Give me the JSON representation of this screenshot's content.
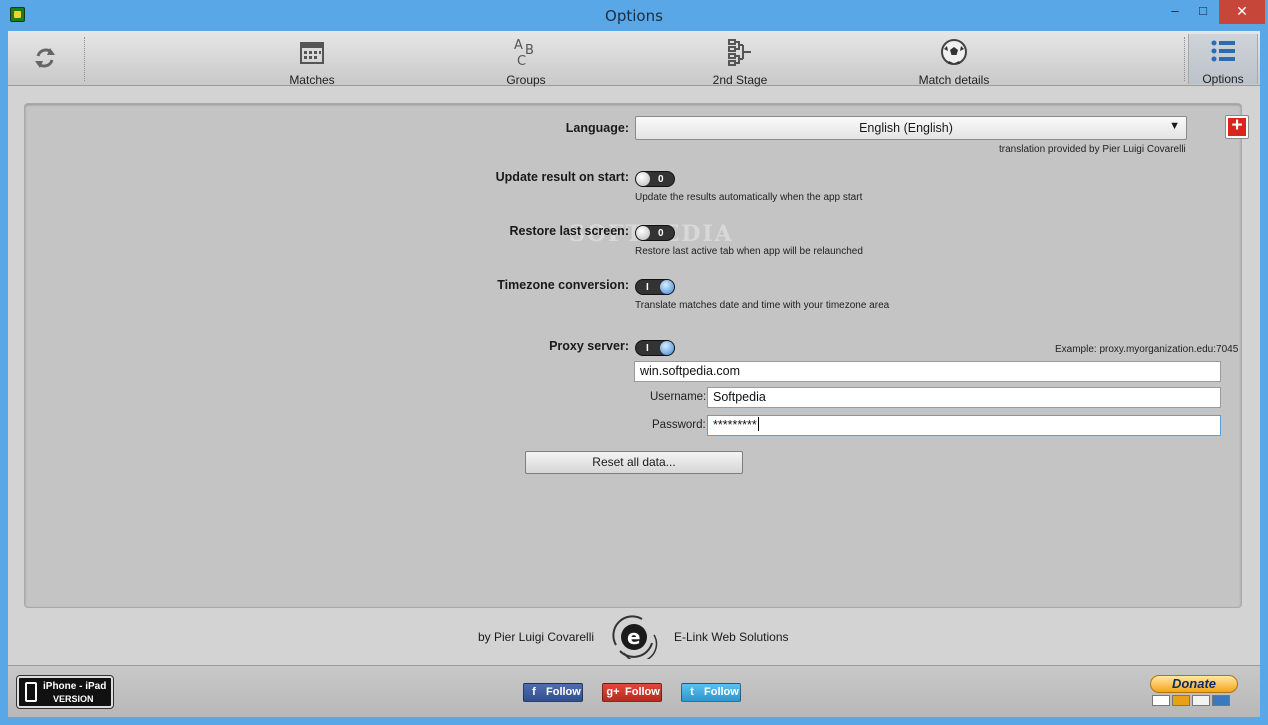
{
  "window": {
    "title": "Options",
    "minimize": "–",
    "maximize": "□",
    "close": "✕"
  },
  "toolbar": {
    "tabs": [
      {
        "label": "Matches",
        "icon": "calendar-icon"
      },
      {
        "label": "Groups",
        "icon": "abc-icon"
      },
      {
        "label": "2nd Stage",
        "icon": "bracket-icon"
      },
      {
        "label": "Match details",
        "icon": "soccer-ball-icon"
      },
      {
        "label": "Options",
        "icon": "list-icon",
        "active": true
      }
    ]
  },
  "options": {
    "language_label": "Language:",
    "language_value": "English (English)",
    "translation_credit": "translation provided by Pier Luigi Covarelli",
    "update_label": "Update result on start:",
    "update_state": "0",
    "update_hint": "Update the results automatically when the app start",
    "restore_label": "Restore last screen:",
    "restore_state": "0",
    "restore_hint": "Restore last active tab when app will be relaunched",
    "timezone_label": "Timezone conversion:",
    "timezone_state": "I",
    "timezone_hint": "Translate matches date and time with your timezone area",
    "proxy_label": "Proxy server:",
    "proxy_state": "I",
    "proxy_example": "Example: proxy.myorganization.edu:7045",
    "proxy_host": "win.softpedia.com",
    "username_label": "Username:",
    "username_value": "Softpedia",
    "password_label": "Password:",
    "password_value": "*********",
    "reset_button": "Reset all data...",
    "watermark": "SOFTPEDIA"
  },
  "credits": {
    "author": "by Pier Luigi Covarelli",
    "company": "E-Link Web Solutions"
  },
  "bottombar": {
    "iphone_line1": "iPhone - iPad",
    "iphone_line2": "VERSION",
    "facebook": "Follow",
    "googleplus": "Follow",
    "twitter": "Follow",
    "donate": "Donate",
    "facebook_glyph": "f",
    "googleplus_glyph": "g+",
    "twitter_glyph": "t"
  },
  "colors": {
    "titlebar": "#59a7e6",
    "close": "#c7463a",
    "toggle_on": "#3a86d6",
    "flag_red": "#d8261f"
  }
}
